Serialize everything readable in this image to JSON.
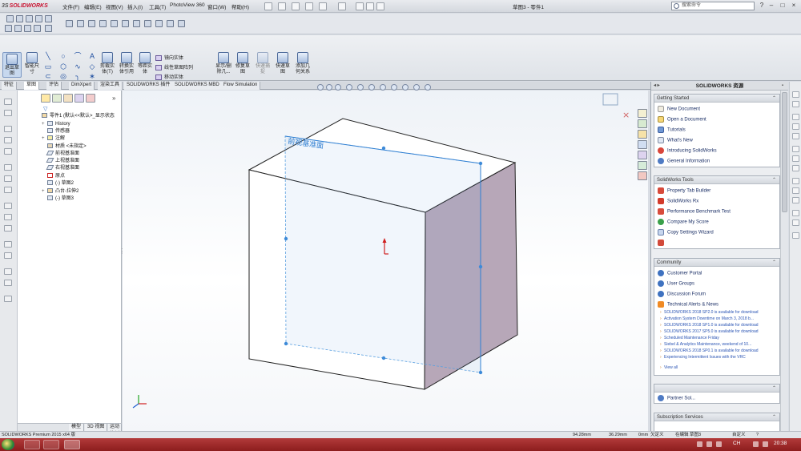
{
  "app": {
    "logo": "SOLIDWORKS",
    "document_title": "草图3 - 零件1",
    "search_placeholder": "搜索命令"
  },
  "menu": [
    "文件(F)",
    "编辑(E)",
    "视图(V)",
    "插入(I)",
    "工具(T)",
    "PhotoView 360",
    "窗口(W)",
    "帮助(H)"
  ],
  "commands": [
    {
      "label": "退出草\n图"
    },
    {
      "label": "智能尺\n寸"
    },
    {
      "label": "剪裁实\n体(T)"
    },
    {
      "label": "转换实\n体引用"
    },
    {
      "label": "等距实\n体"
    },
    {
      "label": "显示/删\n除几..."
    },
    {
      "label": "修复草\n图"
    },
    {
      "label": "快速捕\n捉"
    },
    {
      "label": "快速草\n图"
    },
    {
      "label": "添加几\n何关系"
    }
  ],
  "feature_tools": [
    "镜向实体",
    "线性草图阵列",
    "移动实体"
  ],
  "tabs": [
    "特征",
    "草图",
    "评估",
    "DimXpert",
    "渲染工具",
    "SOLIDWORKS 插件",
    "SOLIDWORKS MBD",
    "Flow Simulation"
  ],
  "active_tab": "草图",
  "tree": [
    {
      "label": "零件1 (默认<<默认>_显示状态",
      "exp": ""
    },
    {
      "label": "History",
      "exp": "+"
    },
    {
      "label": "传感器",
      "exp": ""
    },
    {
      "label": "注解",
      "exp": "+"
    },
    {
      "label": "材质 <未指定>",
      "exp": ""
    },
    {
      "label": "前视基准面",
      "exp": ""
    },
    {
      "label": "上视基准面",
      "exp": ""
    },
    {
      "label": "右视基准面",
      "exp": ""
    },
    {
      "label": "原点",
      "exp": ""
    },
    {
      "label": "(-) 草图2",
      "exp": ""
    },
    {
      "label": "凸台-拉伸2",
      "exp": "+"
    },
    {
      "label": "(-) 草图3",
      "exp": ""
    }
  ],
  "bottom_tabs": [
    "模型",
    "3D 视图",
    "运动算例1"
  ],
  "viewport": {
    "plane_label": "前视基准面"
  },
  "task_pane": {
    "title": "SOLIDWORKS 资源",
    "getting_started": {
      "header": "Getting Started",
      "links": [
        "New Document",
        "Open a Document",
        "Tutorials",
        "What's New",
        "Introducing SolidWorks",
        "General Information"
      ]
    },
    "tools": {
      "header": "SolidWorks Tools",
      "links": [
        "Property Tab Builder",
        "SolidWorks Rx",
        "Performance Benchmark Test",
        "Compare My Score",
        "Copy Settings Wizard"
      ]
    },
    "community": {
      "header": "Community",
      "links": [
        "Customer Portal",
        "User Groups",
        "Discussion Forum",
        "Technical Alerts & News"
      ],
      "news": [
        "SOLIDWORKS 2018 SP2.0 is available for download",
        "Activation System Downtime on March 3, 2018 b...",
        "SOLIDWORKS 2018 SP1.0 is available for download",
        "SOLIDWORKS 2017 SP5.0 is available for download",
        "Scheduled Maintenance Friday",
        "Siebel & Analytics Maintenance, weekend of 10...",
        "SOLIDWORKS 2018 SP0.1 is available for download",
        "Experiencing Intermittent Issues with the VRC"
      ],
      "view_all": "View all"
    },
    "partner": {
      "header": "",
      "link": "Partner Sol..."
    },
    "subscription": {
      "header": "Subscription Services"
    }
  },
  "status": {
    "product": "SOLIDWORKS Premium 2015 x64 版",
    "x": "94.28mm",
    "y": "36.29mm",
    "z": "0mm",
    "state": "欠定义",
    "mode": "在编辑 草图3",
    "units": "自定义"
  },
  "taskbar": {
    "ime": "CH",
    "clock": "20:38"
  }
}
